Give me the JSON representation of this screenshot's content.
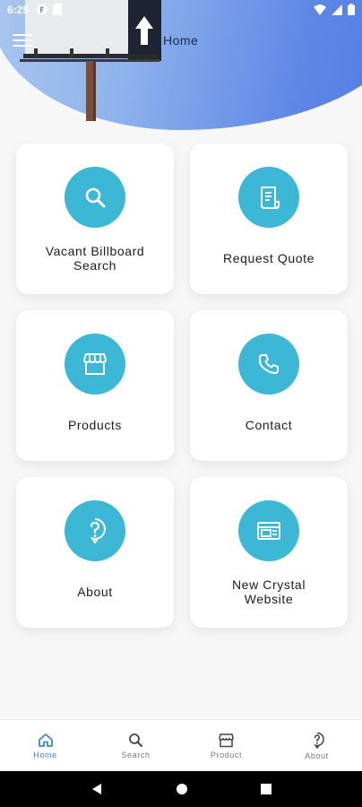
{
  "status_bar": {
    "time": "6:25",
    "icons_left": [
      "app-f-icon",
      "sd-card-icon"
    ],
    "icons_right": [
      "wifi-icon",
      "signal-icon",
      "battery-icon"
    ]
  },
  "header": {
    "title": "Home",
    "menu_icon": "hamburger-menu-icon",
    "hero": "billboard-photo"
  },
  "colors": {
    "accent": "#3cb8d6",
    "nav_active": "#3a86c8",
    "header_gradient_start": "#aec9ee",
    "header_gradient_end": "#4f7ae4"
  },
  "cards": [
    {
      "label": "Vacant Billboard Search",
      "icon": "search-icon"
    },
    {
      "label": "Request Quote",
      "icon": "receipt-icon"
    },
    {
      "label": "Products",
      "icon": "storefront-icon"
    },
    {
      "label": "Contact",
      "icon": "phone-icon"
    },
    {
      "label": "About",
      "icon": "help-bubble-icon"
    },
    {
      "label": "New Crystal Website",
      "icon": "web-window-icon"
    }
  ],
  "bottom_nav": [
    {
      "label": "Home",
      "icon": "home-icon",
      "active": true
    },
    {
      "label": "Search",
      "icon": "search-icon",
      "active": false
    },
    {
      "label": "Product",
      "icon": "storefront-icon",
      "active": false
    },
    {
      "label": "About",
      "icon": "help-bubble-icon",
      "active": false
    }
  ],
  "system_nav": [
    "back-icon",
    "home-circle-icon",
    "recents-icon"
  ]
}
